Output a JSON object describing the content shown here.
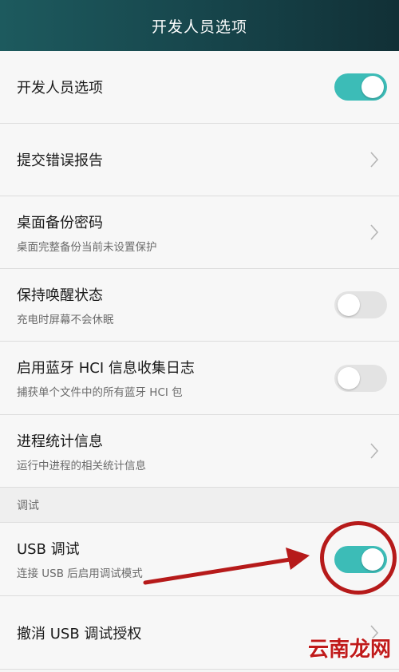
{
  "header": {
    "title": "开发人员选项"
  },
  "rows": [
    {
      "title": "开发人员选项",
      "control": "toggle",
      "state": "on"
    },
    {
      "title": "提交错误报告",
      "control": "chevron"
    },
    {
      "title": "桌面备份密码",
      "subtitle": "桌面完整备份当前未设置保护",
      "control": "chevron"
    },
    {
      "title": "保持唤醒状态",
      "subtitle": "充电时屏幕不会休眠",
      "control": "toggle",
      "state": "off"
    },
    {
      "title": "启用蓝牙 HCI 信息收集日志",
      "subtitle": "捕获单个文件中的所有蓝牙 HCI 包",
      "control": "toggle",
      "state": "off"
    },
    {
      "title": "进程统计信息",
      "subtitle": "运行中进程的相关统计信息",
      "control": "chevron"
    }
  ],
  "section": {
    "label": "调试"
  },
  "debug_rows": [
    {
      "title": "USB 调试",
      "subtitle": "连接 USB 后启用调试模式",
      "control": "toggle",
      "state": "on"
    },
    {
      "title": "撤消 USB 调试授权",
      "control": "chevron"
    }
  ],
  "watermark": "云南龙网",
  "colors": {
    "accent": "#3cbcb7",
    "toggle_off": "#e3e3e3",
    "annotation": "#b61a1a",
    "header": "#17464c"
  }
}
